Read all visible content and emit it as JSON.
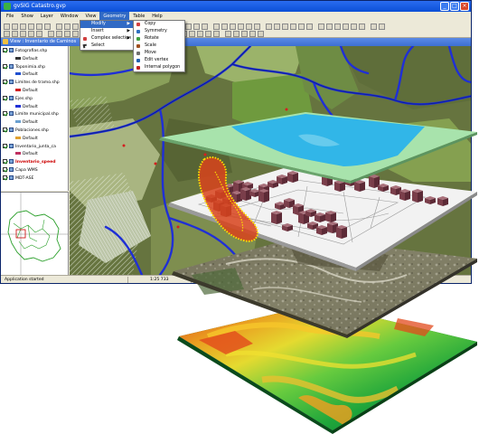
{
  "window": {
    "title": "gvSIG Catastro.gvp",
    "controls": [
      "_",
      "□",
      "×"
    ]
  },
  "menubar": {
    "items": [
      "File",
      "Show",
      "Layer",
      "Window",
      "View",
      "Geometry",
      "Table",
      "Help"
    ],
    "active": "Geometry"
  },
  "geometry_menu": {
    "items": [
      {
        "label": "Modify",
        "submenu": true,
        "highlighted": true
      },
      {
        "label": "Insert",
        "submenu": true
      },
      {
        "label": "Complex selection",
        "submenu": true
      },
      {
        "label": "Select",
        "submenu": false
      }
    ]
  },
  "modify_submenu": {
    "items": [
      "Copy",
      "Symmetry",
      "Rotate",
      "Scale",
      "Move",
      "Edit vertex",
      "Internal polygon"
    ]
  },
  "view": {
    "title": "View : Inventario de Caminos"
  },
  "toc": {
    "layers": [
      {
        "label": "Fotografias.shp",
        "checked": true,
        "indent": 0
      },
      {
        "label": "Default",
        "indent": 1
      },
      {
        "label": "Toponimia.shp",
        "checked": true,
        "indent": 0
      },
      {
        "label": "Default",
        "indent": 1
      },
      {
        "label": "Limites de tramo.shp",
        "checked": true,
        "indent": 0
      },
      {
        "label": "Default",
        "indent": 1
      },
      {
        "label": "Ejes.shp",
        "checked": true,
        "indent": 0
      },
      {
        "label": "Default",
        "indent": 1
      },
      {
        "label": "Limite municipal.shp",
        "checked": true,
        "indent": 0
      },
      {
        "label": "Default",
        "indent": 1
      },
      {
        "label": "Poblaciones.shp",
        "checked": true,
        "indent": 0
      },
      {
        "label": "Default",
        "indent": 1
      },
      {
        "label": "Inventario_junta_ca",
        "checked": true,
        "indent": 0
      },
      {
        "label": "Default",
        "indent": 1
      },
      {
        "label": "Inventario_speed",
        "checked": true,
        "indent": 0,
        "highlight": true
      },
      {
        "label": "Capa WMS",
        "checked": true,
        "indent": 0
      },
      {
        "label": "MDT-ASE",
        "checked": true,
        "indent": 0
      }
    ]
  },
  "statusbar": {
    "message": "Application started",
    "scale": "1:25 733"
  },
  "colors": {
    "titlebar": "#0b4fd6",
    "menu_highlight": "#316ac5",
    "road": "#1f2fd6",
    "water": "#31b6e8",
    "contour": "#ffe100"
  },
  "illustration": {
    "description_layers": [
      "vector-layer",
      "buildings-layer",
      "orthophoto-layer",
      "dem-layer"
    ]
  }
}
